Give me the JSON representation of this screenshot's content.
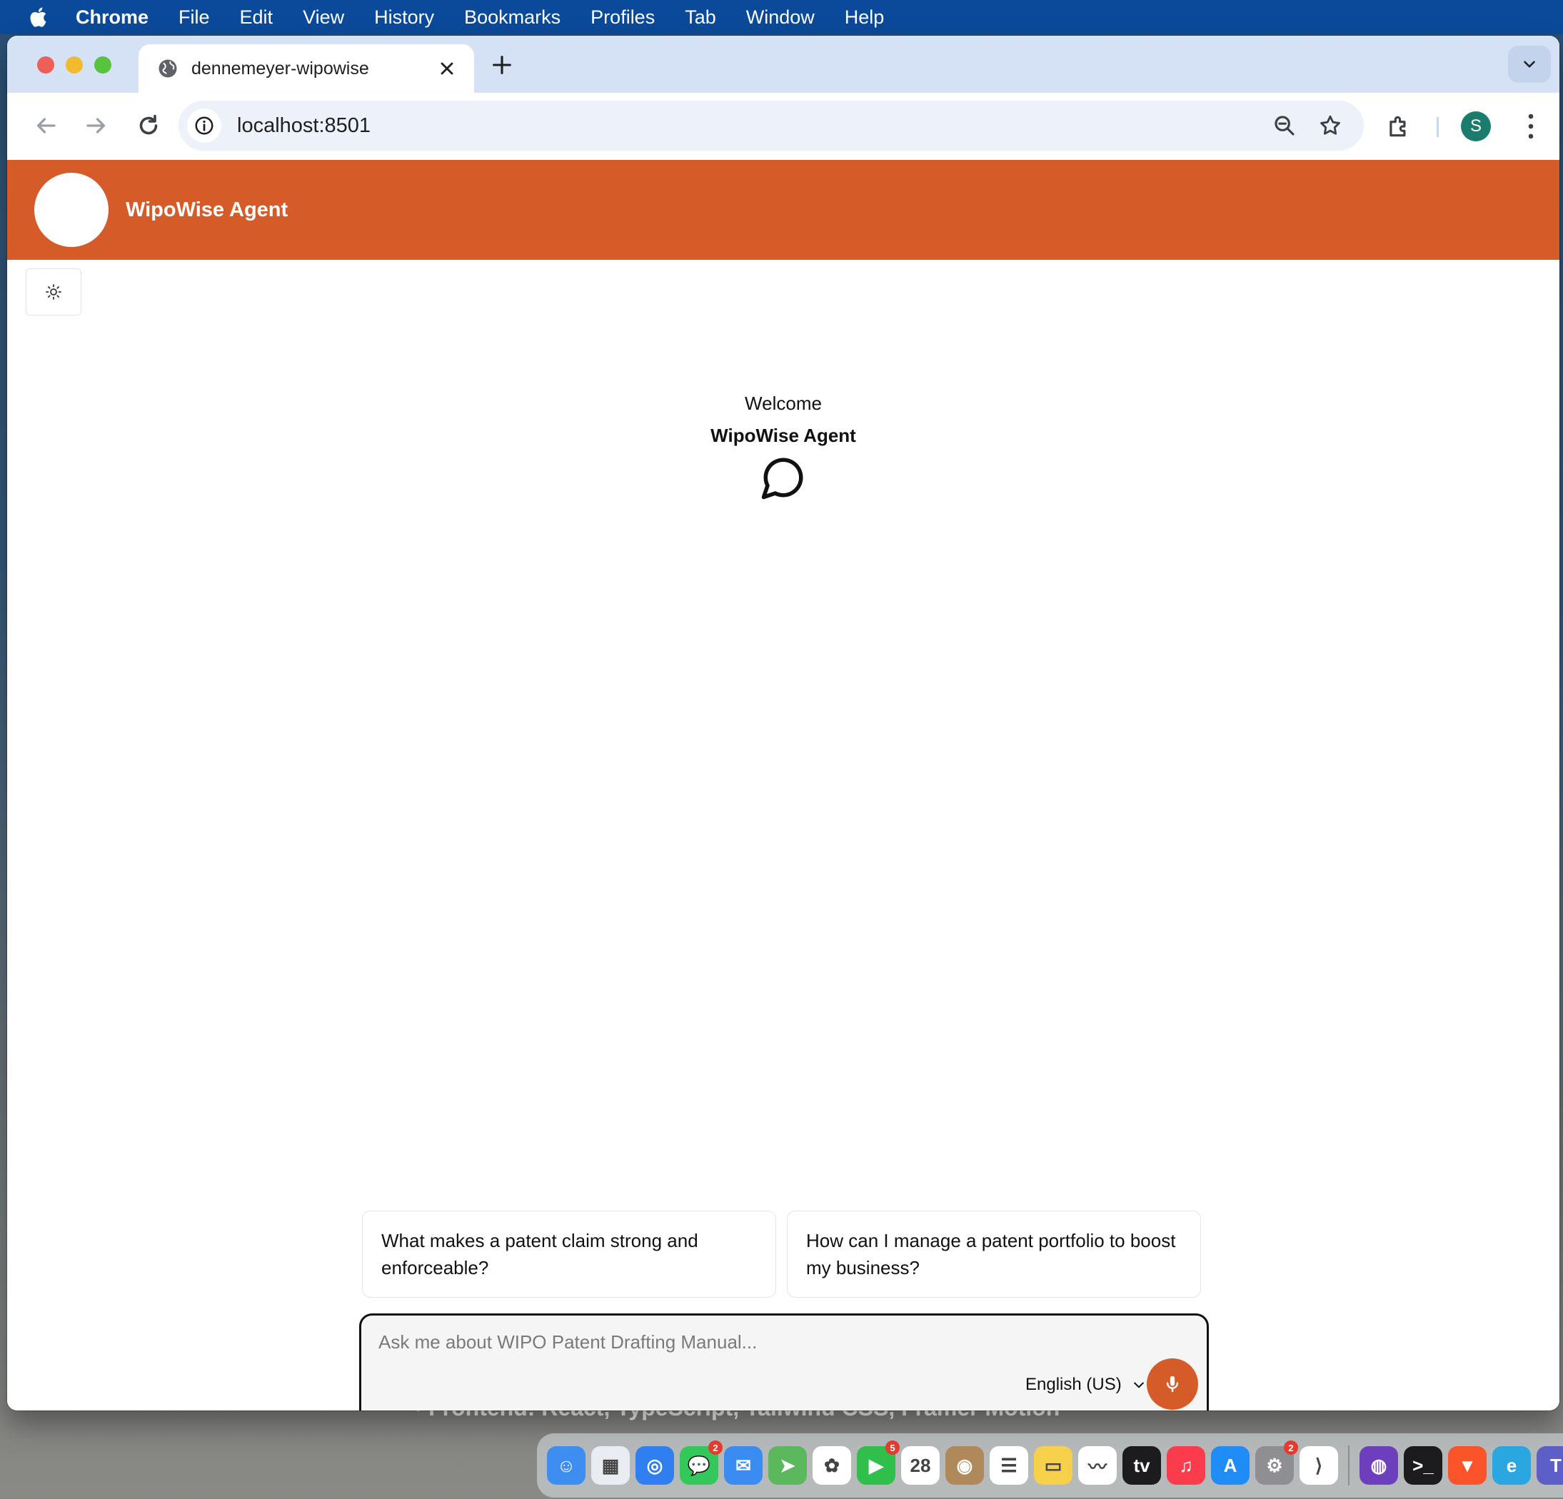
{
  "menubar": {
    "app": "Chrome",
    "items": [
      "File",
      "Edit",
      "View",
      "History",
      "Bookmarks",
      "Profiles",
      "Tab",
      "Window",
      "Help"
    ]
  },
  "browser": {
    "tab_title": "dennemeyer-wipowise",
    "url": "localhost:8501",
    "profile_initial": "S"
  },
  "app": {
    "title": "WipoWise Agent",
    "welcome": "Welcome",
    "welcome_agent": "WipoWise Agent",
    "suggestions": [
      "What makes a patent claim strong and enforceable?",
      "How can I manage a patent portfolio to boost my business?"
    ],
    "input_placeholder": "Ask me about WIPO Patent Drafting Manual...",
    "language": "English (US)",
    "accent_color": "#d55b28"
  },
  "desktop": {
    "behind_text": "• Frontend: React, TypeScript, Tailwind CSS, Framer Motion",
    "dock": [
      {
        "name": "finder",
        "color": "#3d8ef0",
        "glyph": "☺"
      },
      {
        "name": "launchpad",
        "color": "#e9ecf2",
        "glyph": "▦"
      },
      {
        "name": "safari",
        "color": "#2f7ff0",
        "glyph": "◎"
      },
      {
        "name": "messages",
        "color": "#34c759",
        "glyph": "💬",
        "badge": "2"
      },
      {
        "name": "mail",
        "color": "#3a8cf3",
        "glyph": "✉"
      },
      {
        "name": "maps",
        "color": "#5cb85c",
        "glyph": "➤"
      },
      {
        "name": "photos",
        "color": "#ffffff",
        "glyph": "✿"
      },
      {
        "name": "facetime",
        "color": "#2fbf4a",
        "glyph": "▶",
        "badge": "5"
      },
      {
        "name": "calendar",
        "color": "#ffffff",
        "glyph": "28"
      },
      {
        "name": "contacts",
        "color": "#b0895a",
        "glyph": "◉"
      },
      {
        "name": "reminders",
        "color": "#ffffff",
        "glyph": "☰"
      },
      {
        "name": "notes",
        "color": "#f7d04b",
        "glyph": "▭"
      },
      {
        "name": "freeform",
        "color": "#ffffff",
        "glyph": "〰"
      },
      {
        "name": "tv",
        "color": "#1c1c1e",
        "glyph": "tv"
      },
      {
        "name": "music",
        "color": "#fa3c4c",
        "glyph": "♫"
      },
      {
        "name": "app-store",
        "color": "#1f8df5",
        "glyph": "A"
      },
      {
        "name": "system-settings",
        "color": "#8e8e93",
        "glyph": "⚙",
        "badge": "2"
      },
      {
        "name": "vscode",
        "color": "#ffffff",
        "glyph": "⟩"
      },
      {
        "name": "github-desktop",
        "color": "#6e3fbd",
        "glyph": "◍"
      },
      {
        "name": "terminal",
        "color": "#1c1c1e",
        "glyph": ">_"
      },
      {
        "name": "brave",
        "color": "#fb542b",
        "glyph": "▼"
      },
      {
        "name": "edge",
        "color": "#2aa7e0",
        "glyph": "e"
      },
      {
        "name": "teams",
        "color": "#5b5fc7",
        "glyph": "T"
      }
    ]
  }
}
